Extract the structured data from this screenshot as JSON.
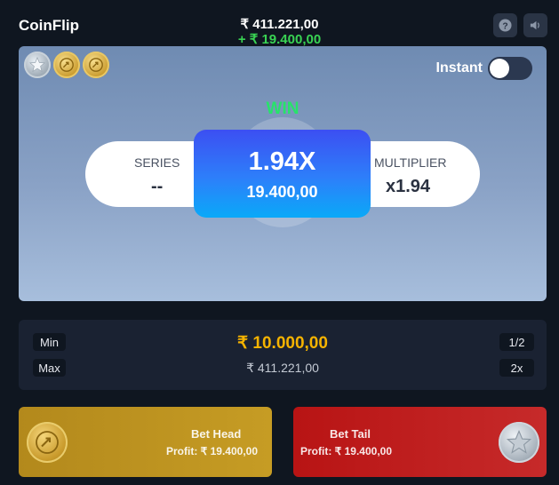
{
  "header": {
    "title": "CoinFlip",
    "balance": "₹ 411.221,00",
    "balance_change": "+ ₹ 19.400,00",
    "help_icon": "question-circle-icon",
    "sound_icon": "speaker-icon"
  },
  "history": [
    {
      "side": "tail",
      "icon": "star-coin-icon"
    },
    {
      "side": "head",
      "icon": "head-coin-icon"
    },
    {
      "side": "head",
      "icon": "head-coin-icon"
    }
  ],
  "instant": {
    "label": "Instant",
    "enabled": false
  },
  "round": {
    "result_label": "WIN",
    "series_label": "SERIES",
    "series_value": "--",
    "multiplier_label": "MULTIPLIER",
    "multiplier_value": "x1.94",
    "win_multiplier": "1.94X",
    "win_amount": "19.400,00"
  },
  "bet_amount": {
    "min_label": "Min",
    "max_label": "Max",
    "half_label": "1/2",
    "double_label": "2x",
    "current": "₹ 10.000,00",
    "max_value": "₹ 411.221,00"
  },
  "bets": {
    "head": {
      "label": "Bet Head",
      "profit": "Profit: ₹ 19.400,00",
      "icon": "head-coin-icon"
    },
    "tail": {
      "label": "Bet Tail",
      "profit": "Profit: ₹ 19.400,00",
      "icon": "star-coin-icon"
    }
  },
  "colors": {
    "win": "#27e36a",
    "amount": "#f5b300",
    "head": "#b3891c",
    "tail": "#b81414",
    "card_top": "#3c4ff2",
    "card_bottom": "#0aa9f8"
  }
}
